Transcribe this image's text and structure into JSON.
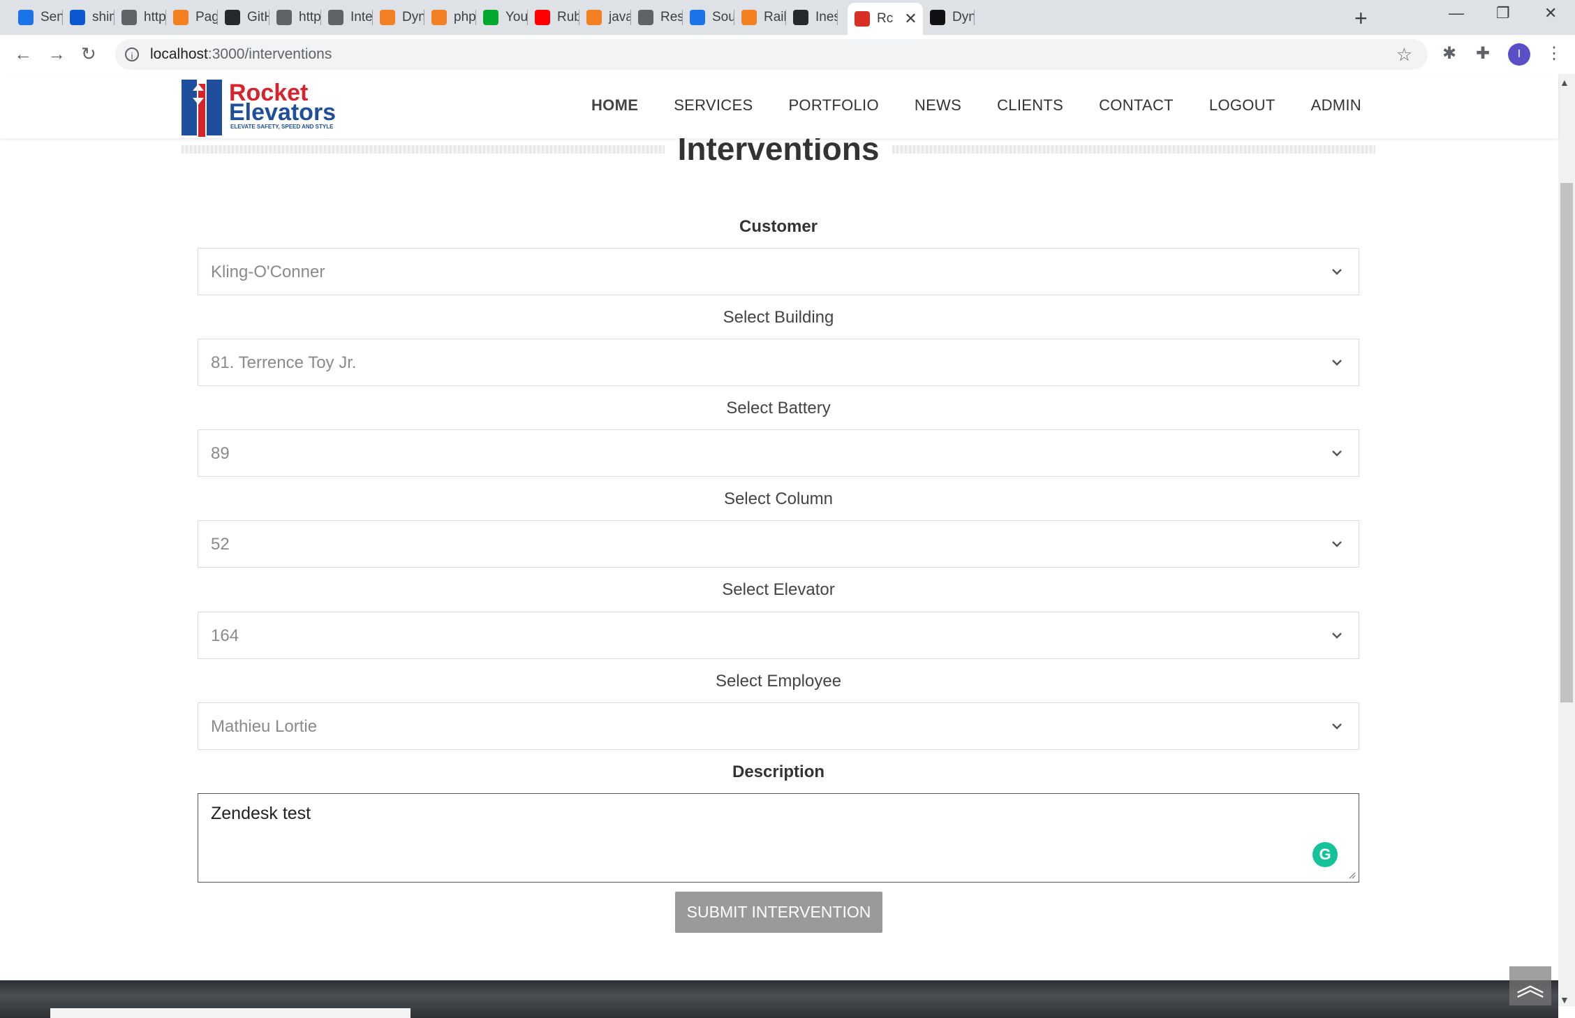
{
  "browser": {
    "tabs": [
      {
        "label": "Send(",
        "color": "#1a73e8"
      },
      {
        "label": "shimv",
        "color": "#0b57d0"
      },
      {
        "label": "https:",
        "color": "#5f6368"
      },
      {
        "label": "Page",
        "color": "#f48120"
      },
      {
        "label": "GitHu",
        "color": "#24292e"
      },
      {
        "label": "https:",
        "color": "#5f6368"
      },
      {
        "label": "Interv",
        "color": "#5f6368"
      },
      {
        "label": "Dynar",
        "color": "#f48024"
      },
      {
        "label": "php -",
        "color": "#f48024"
      },
      {
        "label": "You h",
        "color": "#00a82d"
      },
      {
        "label": "Ruby",
        "color": "#ff0000"
      },
      {
        "label": "javasc",
        "color": "#f48024"
      },
      {
        "label": "Reset",
        "color": "#5f6368"
      },
      {
        "label": "Sourc",
        "color": "#1a73e8"
      },
      {
        "label": "Rails:",
        "color": "#f48024"
      },
      {
        "label": "Ineslz",
        "color": "#24292e"
      },
      {
        "label": "Rc",
        "color": "#d93025"
      },
      {
        "label": "Dynar",
        "color": "#111111"
      }
    ],
    "url_host": "localhost",
    "url_path": ":3000/interventions",
    "profile_initial": "I"
  },
  "header": {
    "logo_line1": "Rocket",
    "logo_line2": "Elevators",
    "logo_tagline": "ELEVATE SAFETY, SPEED AND STYLE",
    "nav": [
      "HOME",
      "SERVICES",
      "PORTFOLIO",
      "NEWS",
      "CLIENTS",
      "CONTACT",
      "LOGOUT",
      "ADMIN"
    ]
  },
  "form": {
    "title": "Interventions",
    "customer_label": "Customer",
    "customer_value": "Kling-O'Conner",
    "building_label": "Select Building",
    "building_value": "81. Terrence Toy Jr.",
    "battery_label": "Select Battery",
    "battery_value": "89",
    "column_label": "Select Column",
    "column_value": "52",
    "elevator_label": "Select Elevator",
    "elevator_value": "164",
    "employee_label": "Select Employee",
    "employee_value": "Mathieu Lortie",
    "description_label": "Description",
    "description_value": "Zendesk test",
    "submit_label": "SUBMIT INTERVENTION"
  },
  "colors": {
    "logo_red": "#d7232b",
    "logo_blue": "#1f4e9c",
    "grammarly": "#15c39a"
  }
}
